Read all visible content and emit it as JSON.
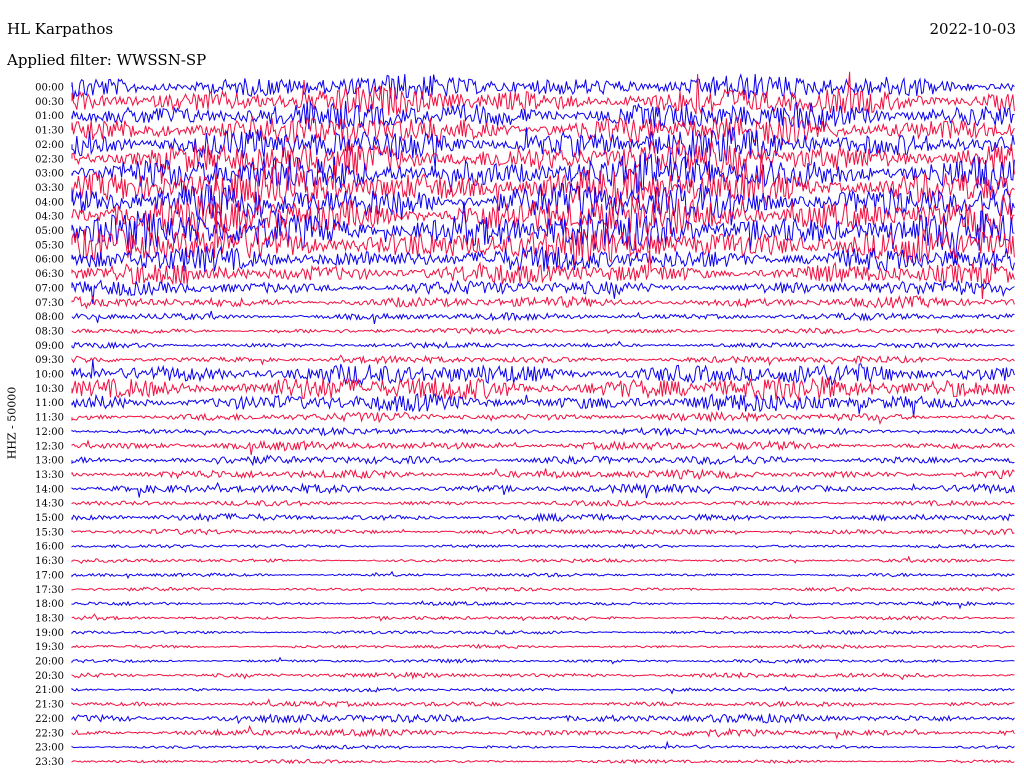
{
  "header": {
    "station": "HL Karpathos",
    "filter": "Applied filter: WWSSN-SP",
    "date": "2022-10-03"
  },
  "colors": {
    "trace_a": "#0b00ee",
    "trace_b": "#f01040",
    "text": "#000000"
  },
  "chart_data": {
    "type": "line",
    "title": "HL Karpathos",
    "subtitle": "Applied filter: WWSSN-SP",
    "date": "2022-10-03",
    "ylabel": "HHZ - 50000",
    "xlabel": "",
    "y_tick_labels": [
      "00:00",
      "00:30",
      "01:00",
      "01:30",
      "02:00",
      "02:30",
      "03:00",
      "03:30",
      "04:00",
      "04:30",
      "05:00",
      "05:30",
      "06:00",
      "06:30",
      "07:00",
      "07:30",
      "08:00",
      "08:30",
      "09:00",
      "09:30",
      "10:00",
      "10:30",
      "11:00",
      "11:30",
      "12:00",
      "12:30",
      "13:00",
      "13:30",
      "14:00",
      "14:30",
      "15:00",
      "15:30",
      "16:00",
      "16:30",
      "17:00",
      "17:30",
      "18:00",
      "18:30",
      "19:00",
      "19:30",
      "20:00",
      "20:30",
      "21:00",
      "21:30",
      "22:00",
      "22:30",
      "23:00",
      "23:30"
    ],
    "series": [
      {
        "name": "",
        "color": "#0b00ee",
        "rows": "even (00:00, 01:00, ...)"
      },
      {
        "name": "",
        "color": "#f01040",
        "rows": "odd (00:30, 01:30, ...)"
      }
    ],
    "rows": [
      {
        "t": "00:00",
        "amp": 14
      },
      {
        "t": "00:30",
        "amp": 16
      },
      {
        "t": "01:00",
        "amp": 16
      },
      {
        "t": "01:30",
        "amp": 17
      },
      {
        "t": "02:00",
        "amp": 18
      },
      {
        "t": "02:30",
        "amp": 19
      },
      {
        "t": "03:00",
        "amp": 21
      },
      {
        "t": "03:30",
        "amp": 22
      },
      {
        "t": "04:00",
        "amp": 22
      },
      {
        "t": "04:30",
        "amp": 22
      },
      {
        "t": "05:00",
        "amp": 22
      },
      {
        "t": "05:30",
        "amp": 21
      },
      {
        "t": "06:00",
        "amp": 14
      },
      {
        "t": "06:30",
        "amp": 12
      },
      {
        "t": "07:00",
        "amp": 8
      },
      {
        "t": "07:30",
        "amp": 6
      },
      {
        "t": "08:00",
        "amp": 4
      },
      {
        "t": "08:30",
        "amp": 3
      },
      {
        "t": "09:00",
        "amp": 3
      },
      {
        "t": "09:30",
        "amp": 4
      },
      {
        "t": "10:00",
        "amp": 12
      },
      {
        "t": "10:30",
        "amp": 14
      },
      {
        "t": "11:00",
        "amp": 10
      },
      {
        "t": "11:30",
        "amp": 5
      },
      {
        "t": "12:00",
        "amp": 4
      },
      {
        "t": "12:30",
        "amp": 5
      },
      {
        "t": "13:00",
        "amp": 5
      },
      {
        "t": "13:30",
        "amp": 5
      },
      {
        "t": "14:00",
        "amp": 5
      },
      {
        "t": "14:30",
        "amp": 3
      },
      {
        "t": "15:00",
        "amp": 4
      },
      {
        "t": "15:30",
        "amp": 3
      },
      {
        "t": "16:00",
        "amp": 2
      },
      {
        "t": "16:30",
        "amp": 2
      },
      {
        "t": "17:00",
        "amp": 2
      },
      {
        "t": "17:30",
        "amp": 2
      },
      {
        "t": "18:00",
        "amp": 2
      },
      {
        "t": "18:30",
        "amp": 2
      },
      {
        "t": "19:00",
        "amp": 2
      },
      {
        "t": "19:30",
        "amp": 2
      },
      {
        "t": "20:00",
        "amp": 2
      },
      {
        "t": "20:30",
        "amp": 3
      },
      {
        "t": "21:00",
        "amp": 2
      },
      {
        "t": "21:30",
        "amp": 3
      },
      {
        "t": "22:00",
        "amp": 5
      },
      {
        "t": "22:30",
        "amp": 4
      },
      {
        "t": "23:00",
        "amp": 2
      },
      {
        "t": "23:30",
        "amp": 2
      }
    ],
    "grid": false,
    "legend": "none"
  }
}
